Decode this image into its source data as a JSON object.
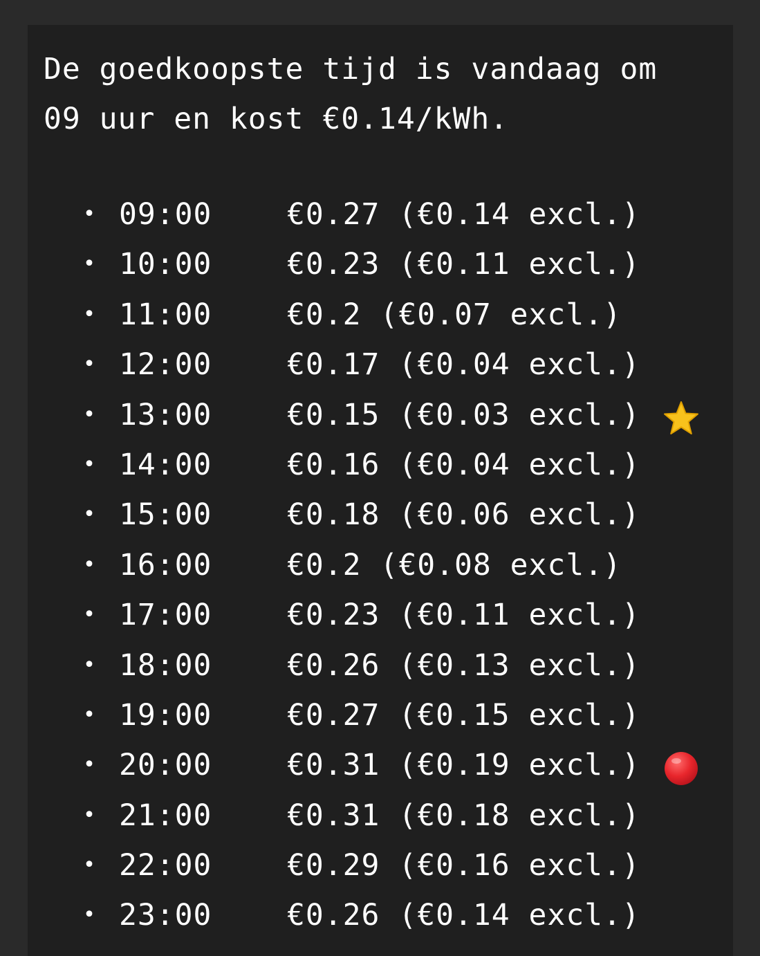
{
  "intro_text": "De goedkoopste tijd is vandaag om\n09 uur en kost €0.14/kWh.",
  "rows": [
    {
      "hour": "09:00",
      "price": "€0.27 (€0.14 excl.)",
      "marker": ""
    },
    {
      "hour": "10:00",
      "price": "€0.23 (€0.11 excl.)",
      "marker": ""
    },
    {
      "hour": "11:00",
      "price": "€0.2 (€0.07 excl.)",
      "marker": ""
    },
    {
      "hour": "12:00",
      "price": "€0.17 (€0.04 excl.)",
      "marker": ""
    },
    {
      "hour": "13:00",
      "price": "€0.15 (€0.03 excl.)",
      "marker": "star-icon"
    },
    {
      "hour": "14:00",
      "price": "€0.16 (€0.04 excl.)",
      "marker": ""
    },
    {
      "hour": "15:00",
      "price": "€0.18 (€0.06 excl.)",
      "marker": ""
    },
    {
      "hour": "16:00",
      "price": "€0.2 (€0.08 excl.)",
      "marker": ""
    },
    {
      "hour": "17:00",
      "price": "€0.23 (€0.11 excl.)",
      "marker": ""
    },
    {
      "hour": "18:00",
      "price": "€0.26 (€0.13 excl.)",
      "marker": ""
    },
    {
      "hour": "19:00",
      "price": "€0.27 (€0.15 excl.)",
      "marker": ""
    },
    {
      "hour": "20:00",
      "price": "€0.31 (€0.19 excl.)",
      "marker": "red-circle-icon"
    },
    {
      "hour": "21:00",
      "price": "€0.31 (€0.18 excl.)",
      "marker": ""
    },
    {
      "hour": "22:00",
      "price": "€0.29 (€0.16 excl.)",
      "marker": ""
    },
    {
      "hour": "23:00",
      "price": "€0.26 (€0.14 excl.)",
      "marker": ""
    }
  ],
  "colors": {
    "page_background": "#2a2a2a",
    "card_background": "#1f1f1f",
    "text": "#ffffff",
    "star": "#f8c21c",
    "red_circle": "#e8262c"
  }
}
